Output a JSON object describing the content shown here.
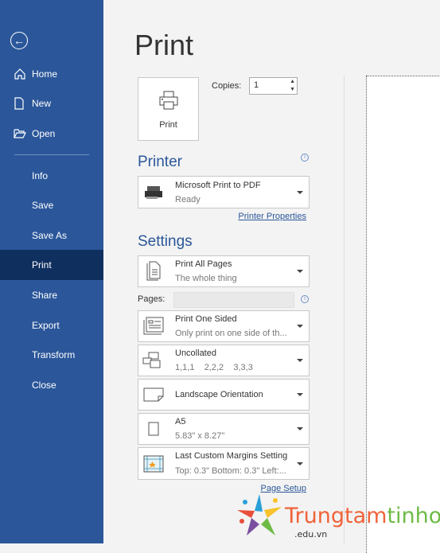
{
  "sidebar": {
    "items": [
      {
        "label": "Home",
        "icon": "home-icon"
      },
      {
        "label": "New",
        "icon": "new-document-icon"
      },
      {
        "label": "Open",
        "icon": "folder-open-icon"
      },
      {
        "label": "Info"
      },
      {
        "label": "Save"
      },
      {
        "label": "Save As"
      },
      {
        "label": "Print",
        "selected": true
      },
      {
        "label": "Share"
      },
      {
        "label": "Export"
      },
      {
        "label": "Transform"
      },
      {
        "label": "Close"
      }
    ]
  },
  "main": {
    "title": "Print",
    "print_button": "Print",
    "copies_label": "Copies:",
    "copies_value": "1",
    "printer_heading": "Printer",
    "printer": {
      "name": "Microsoft Print to PDF",
      "status": "Ready"
    },
    "printer_properties": "Printer Properties",
    "settings_heading": "Settings",
    "settings": [
      {
        "title": "Print All Pages",
        "subtitle": "The whole thing"
      },
      {
        "title": "Print One Sided",
        "subtitle": "Only print on one side of th..."
      },
      {
        "title": "Uncollated",
        "subtitle": "1,1,1    2,2,2    3,3,3"
      },
      {
        "title": "Landscape Orientation",
        "subtitle": ""
      },
      {
        "title": "A5",
        "subtitle": "5.83\" x 8.27\""
      },
      {
        "title": "Last Custom Margins Setting",
        "subtitle": "Top: 0.3\" Bottom: 0.3\" Left:..."
      }
    ],
    "pages_label": "Pages:",
    "pages_value": "",
    "page_setup": "Page Setup"
  },
  "watermark": {
    "brand": "Trungtamtinhoc",
    "domain": ".edu.vn"
  },
  "colors": {
    "sidebar": "#2b579a",
    "selected": "#0f2f5f",
    "accent": "#2b579a"
  }
}
